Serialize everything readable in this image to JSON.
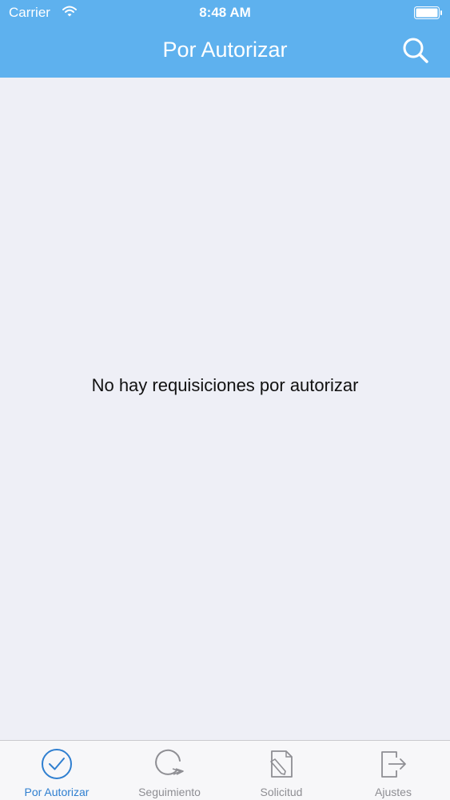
{
  "status_bar": {
    "carrier": "Carrier",
    "time": "8:48 AM",
    "wifi_icon": "wifi-icon",
    "battery_icon": "battery-icon"
  },
  "nav_bar": {
    "title": "Por Autorizar",
    "search_icon": "search-icon"
  },
  "main": {
    "empty_message": "No hay requisiciones por autorizar"
  },
  "tab_bar": {
    "tabs": [
      {
        "label": "Por Autorizar",
        "icon": "checkmark-circle-icon",
        "active": true
      },
      {
        "label": "Seguimiento",
        "icon": "refresh-arrow-icon",
        "active": false
      },
      {
        "label": "Solicitud",
        "icon": "edit-document-icon",
        "active": false
      },
      {
        "label": "Ajustes",
        "icon": "logout-icon",
        "active": false
      }
    ]
  },
  "colors": {
    "header": "#5eb1ee",
    "background": "#eeeff6",
    "tab_active": "#2f7fd0",
    "tab_inactive": "#8e8e93"
  }
}
